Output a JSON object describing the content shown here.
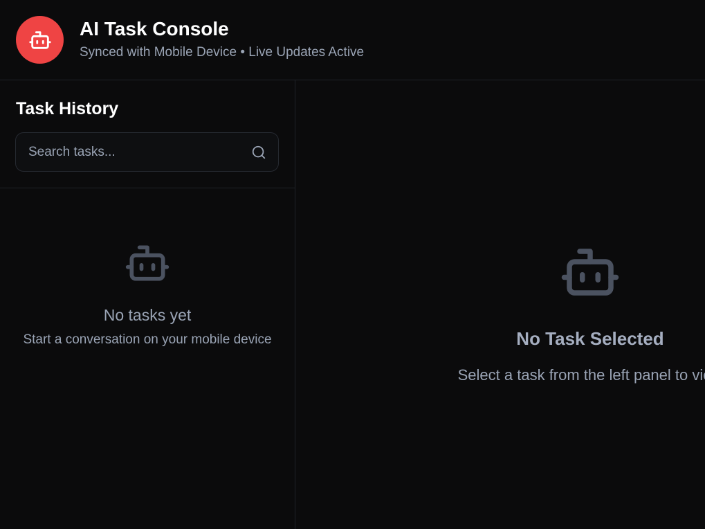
{
  "header": {
    "title": "AI Task Console",
    "subtitle": "Synced with Mobile Device • Live Updates Active",
    "logo_icon": "robot-icon",
    "logo_color": "#ef4444"
  },
  "sidebar": {
    "title": "Task History",
    "search": {
      "placeholder": "Search tasks...",
      "value": "",
      "icon": "search-icon"
    },
    "empty_state": {
      "icon": "robot-icon",
      "title": "No tasks yet",
      "subtitle": "Start a conversation on your mobile device"
    }
  },
  "main": {
    "empty_state": {
      "icon": "robot-icon",
      "title": "No Task Selected",
      "subtitle": "Select a task from the left panel to view"
    }
  }
}
